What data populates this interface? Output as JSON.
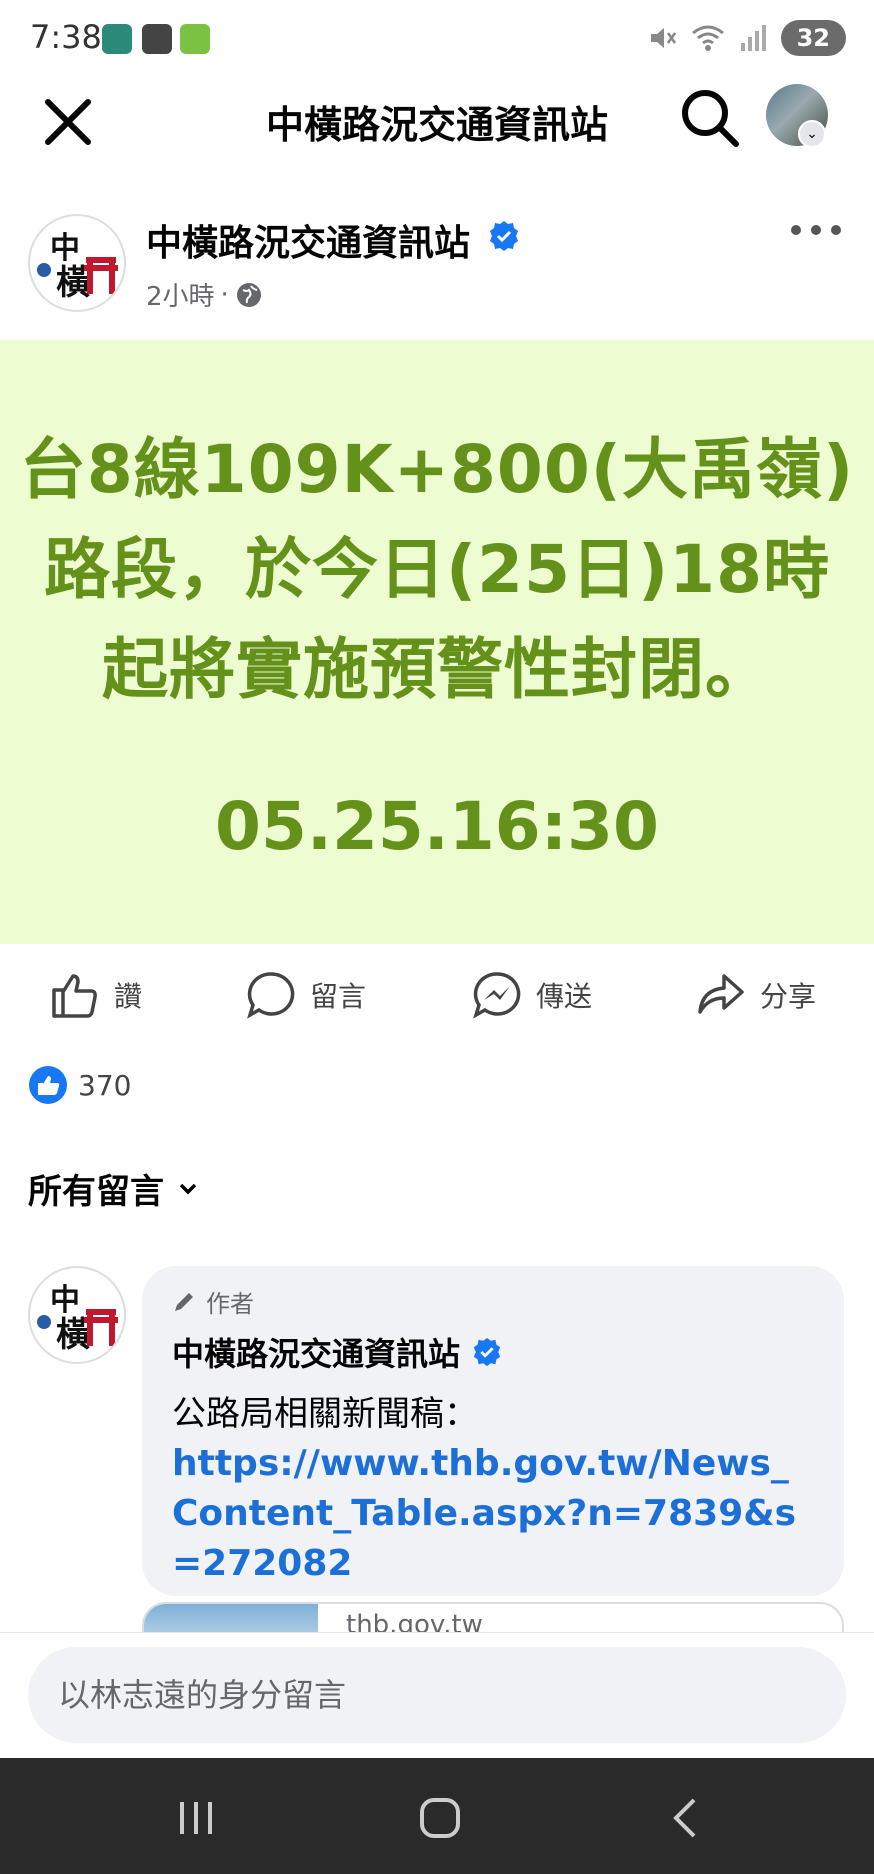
{
  "status_bar": {
    "time": "7:38",
    "battery": "32"
  },
  "nav": {
    "title": "中橫路況交通資訊站"
  },
  "post": {
    "page_name": "中橫路況交通資訊站",
    "time_ago": "2小時",
    "separator": "·",
    "lines": [
      "台8線109K+800(大禹嶺)",
      "路段，於今日(25日)18時",
      "起將實施預警性封閉。"
    ],
    "timestamp": "05.25.16:30",
    "colors": {
      "background": "#eefcd2",
      "text": "#64911a"
    }
  },
  "actions": {
    "like": "讚",
    "comment": "留言",
    "send": "傳送",
    "share": "分享"
  },
  "reactions": {
    "count": "370"
  },
  "comments": {
    "filter_label": "所有留言",
    "items": [
      {
        "author_badge": "作者",
        "name": "中橫路況交通資訊站",
        "text": "公路局相關新聞稿：",
        "link": "https://www.thb.gov.tw/News_Content_Table.aspx?n=7839&s=272082",
        "preview_domain": "thb.gov.tw"
      }
    ]
  },
  "input": {
    "placeholder": "以林志遠的身分留言"
  },
  "accent_color": "#1877f2"
}
